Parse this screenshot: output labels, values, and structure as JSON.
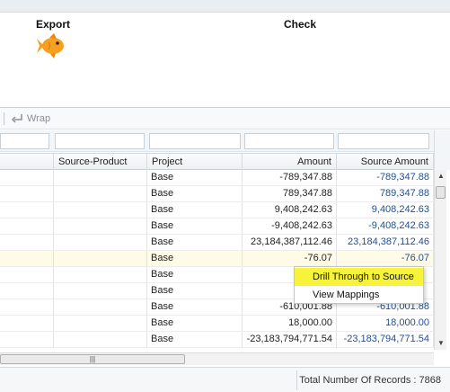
{
  "steps": {
    "export_label": "Export",
    "check_label": "Check"
  },
  "toolbar": {
    "wrap_label": "Wrap"
  },
  "columns": [
    {
      "label": ""
    },
    {
      "label": "Source-Product"
    },
    {
      "label": "Project"
    },
    {
      "label": "Amount"
    },
    {
      "label": "Source Amount"
    }
  ],
  "rows": [
    {
      "project": "Base",
      "amount": "-789,347.88",
      "source_amount": "-789,347.88"
    },
    {
      "project": "Base",
      "amount": "789,347.88",
      "source_amount": "789,347.88"
    },
    {
      "project": "Base",
      "amount": "9,408,242.63",
      "source_amount": "9,408,242.63"
    },
    {
      "project": "Base",
      "amount": "-9,408,242.63",
      "source_amount": "-9,408,242.63"
    },
    {
      "project": "Base",
      "amount": "23,184,387,112.46",
      "source_amount": "23,184,387,112.46"
    },
    {
      "project": "Base",
      "amount": "-76.07",
      "source_amount": "-76.07"
    },
    {
      "project": "Base",
      "amount": "",
      "source_amount": ""
    },
    {
      "project": "Base",
      "amount": "",
      "source_amount": ""
    },
    {
      "project": "Base",
      "amount": "-610,001.88",
      "source_amount": "-610,001.88"
    },
    {
      "project": "Base",
      "amount": "18,000.00",
      "source_amount": "18,000.00"
    },
    {
      "project": "Base",
      "amount": "-23,183,794,771.54",
      "source_amount": "-23,183,794,771.54"
    }
  ],
  "context_menu": {
    "items": [
      {
        "label": "Drill Through to Source"
      },
      {
        "label": "View Mappings"
      }
    ]
  },
  "footer": {
    "total_label": "Total Number Of Records : 7868"
  },
  "colors": {
    "fish": "#f5a020",
    "link_blue": "#1f4f95",
    "menu_highlight": "#f7f33a",
    "row_highlight": "#fffbe6"
  }
}
